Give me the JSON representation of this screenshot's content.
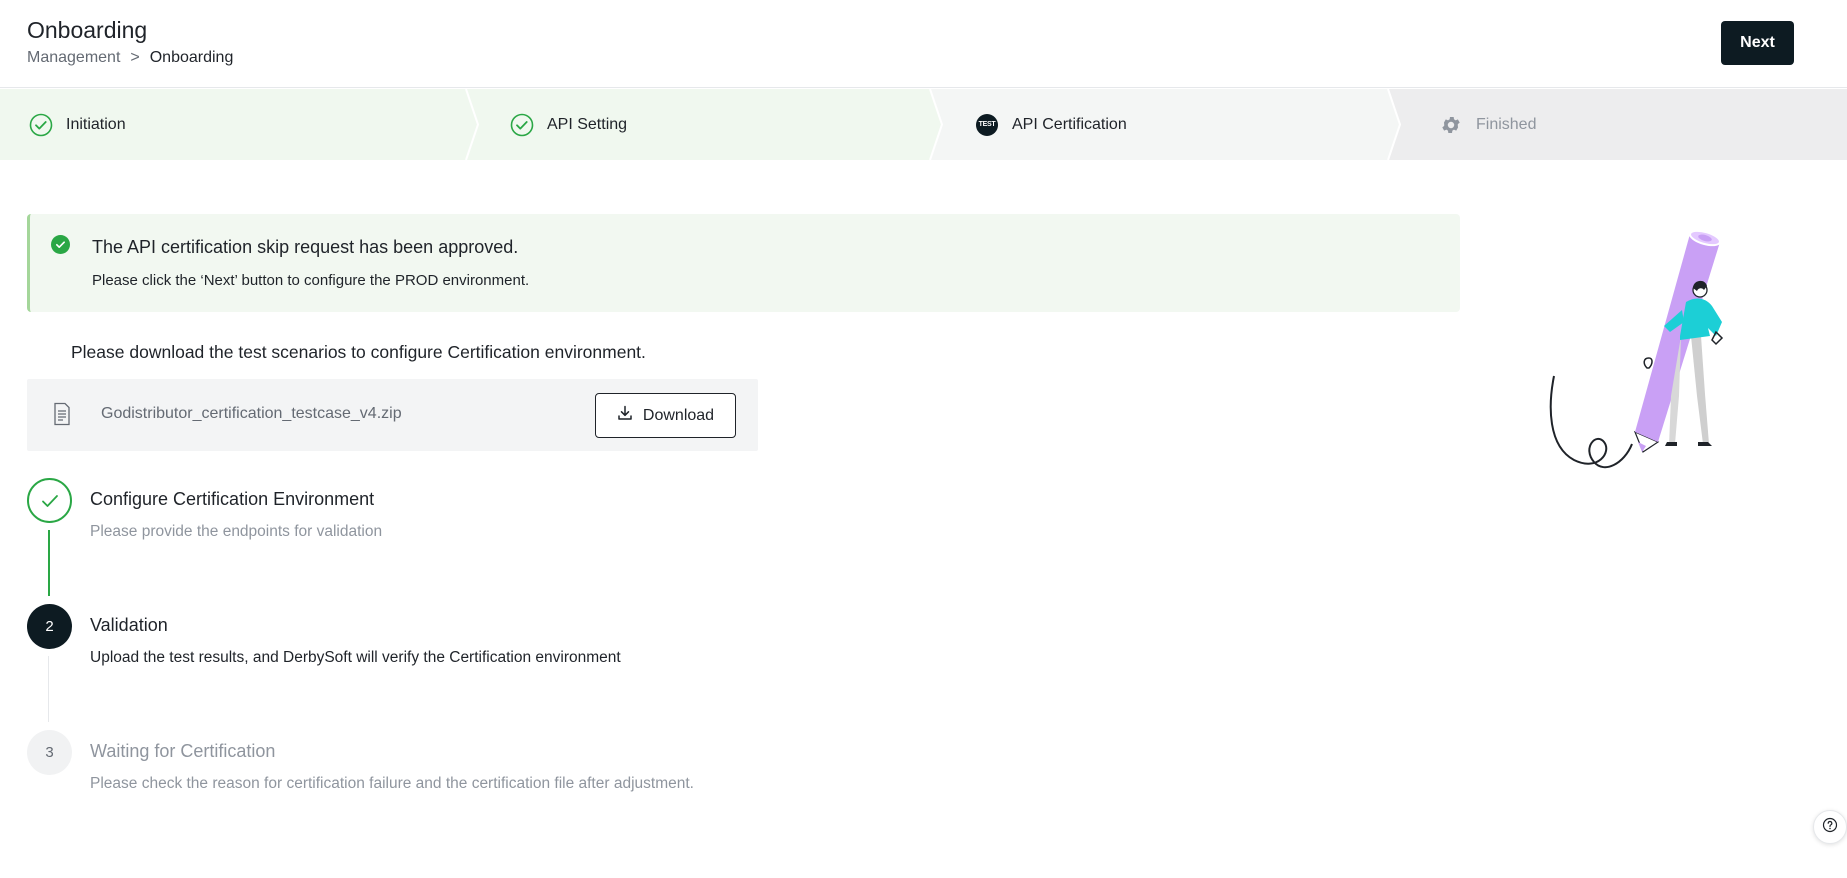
{
  "header": {
    "title": "Onboarding",
    "breadcrumb": [
      "Management",
      ">",
      "Onboarding"
    ],
    "next_label": "Next"
  },
  "steps": [
    {
      "label": "Initiation",
      "state": "done",
      "icon": "check-circle-icon"
    },
    {
      "label": "API Setting",
      "state": "done",
      "icon": "check-circle-icon"
    },
    {
      "label": "API Certification",
      "state": "current",
      "icon": "test-badge-icon",
      "icon_text": "TEST"
    },
    {
      "label": "Finished",
      "state": "pending",
      "icon": "gear-icon"
    }
  ],
  "alert": {
    "title": "The API certification skip request has been approved.",
    "subtitle": "Please click the ‘Next’ button to configure the PROD environment."
  },
  "download": {
    "prompt": "Please download the test scenarios to configure Certification environment.",
    "file_name": "Godistributor_certification_testcase_v4.zip",
    "button_label": "Download"
  },
  "vsteps": [
    {
      "number": "",
      "title": "Configure Certification Environment",
      "desc": "Please provide the endpoints for validation",
      "state": "done"
    },
    {
      "number": "2",
      "title": "Validation",
      "desc": "Upload the test results, and DerbySoft will verify the Certification environment",
      "state": "current"
    },
    {
      "number": "3",
      "title": "Waiting for Certification",
      "desc": "Please check the reason for certification failure and the certification file after adjustment.",
      "state": "pending"
    }
  ],
  "colors": {
    "success": "#2aa745",
    "dark": "#0d1b22",
    "muted": "#8f959e",
    "done_step_bg": "#f0f8ef",
    "current_step_bg": "#f4f6f5",
    "pending_step_bg": "#ededee",
    "pencil": "#c9a0f5",
    "person_shirt": "#1ccfd6"
  }
}
